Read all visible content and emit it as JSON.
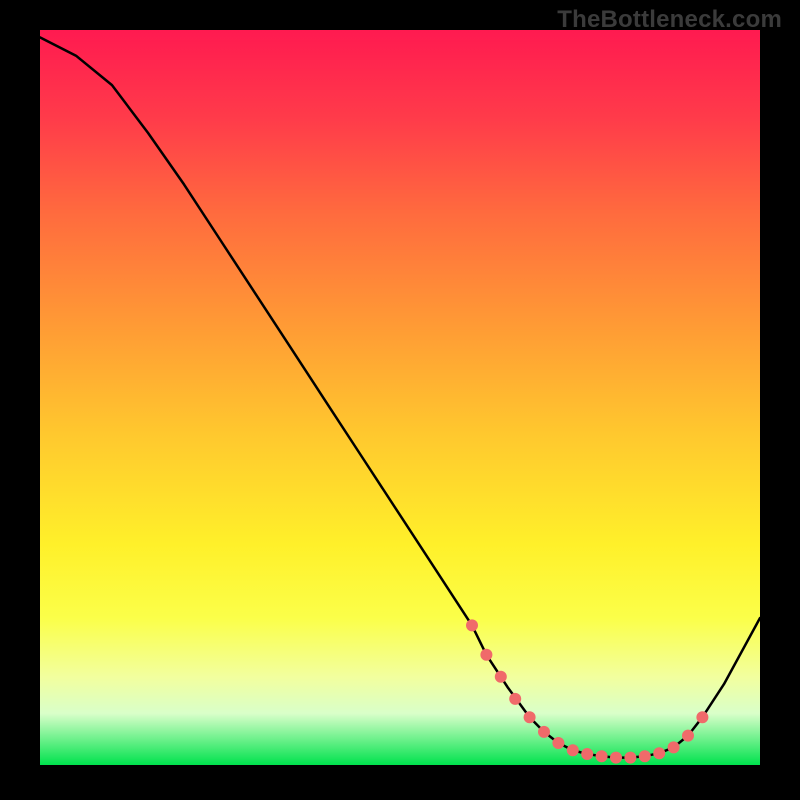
{
  "watermark": "TheBottleneck.com",
  "chart_data": {
    "type": "line",
    "title": "",
    "xlabel": "",
    "ylabel": "",
    "xlim": [
      0,
      100
    ],
    "ylim": [
      0,
      100
    ],
    "series": [
      {
        "name": "curve",
        "x": [
          0,
          5,
          10,
          15,
          20,
          25,
          30,
          35,
          40,
          45,
          50,
          55,
          60,
          62,
          65,
          68,
          70,
          72,
          74,
          76,
          78,
          80,
          82,
          84,
          86,
          88,
          90,
          92,
          95,
          100
        ],
        "y": [
          99,
          96.5,
          92.5,
          86,
          79,
          71.5,
          64,
          56.5,
          49,
          41.5,
          34,
          26.5,
          19,
          15,
          10.5,
          6.5,
          4.5,
          3,
          2,
          1.5,
          1.2,
          1,
          1,
          1.2,
          1.6,
          2.4,
          4,
          6.5,
          11,
          20
        ]
      }
    ],
    "markers": {
      "name": "highlight-dots",
      "color": "#f06a6a",
      "x": [
        60,
        62,
        64,
        66,
        68,
        70,
        72,
        74,
        76,
        78,
        80,
        82,
        84,
        86,
        88,
        90,
        92
      ],
      "y": [
        19,
        15,
        12,
        9,
        6.5,
        4.5,
        3,
        2,
        1.5,
        1.2,
        1,
        1,
        1.2,
        1.6,
        2.4,
        4,
        6.5
      ]
    }
  }
}
